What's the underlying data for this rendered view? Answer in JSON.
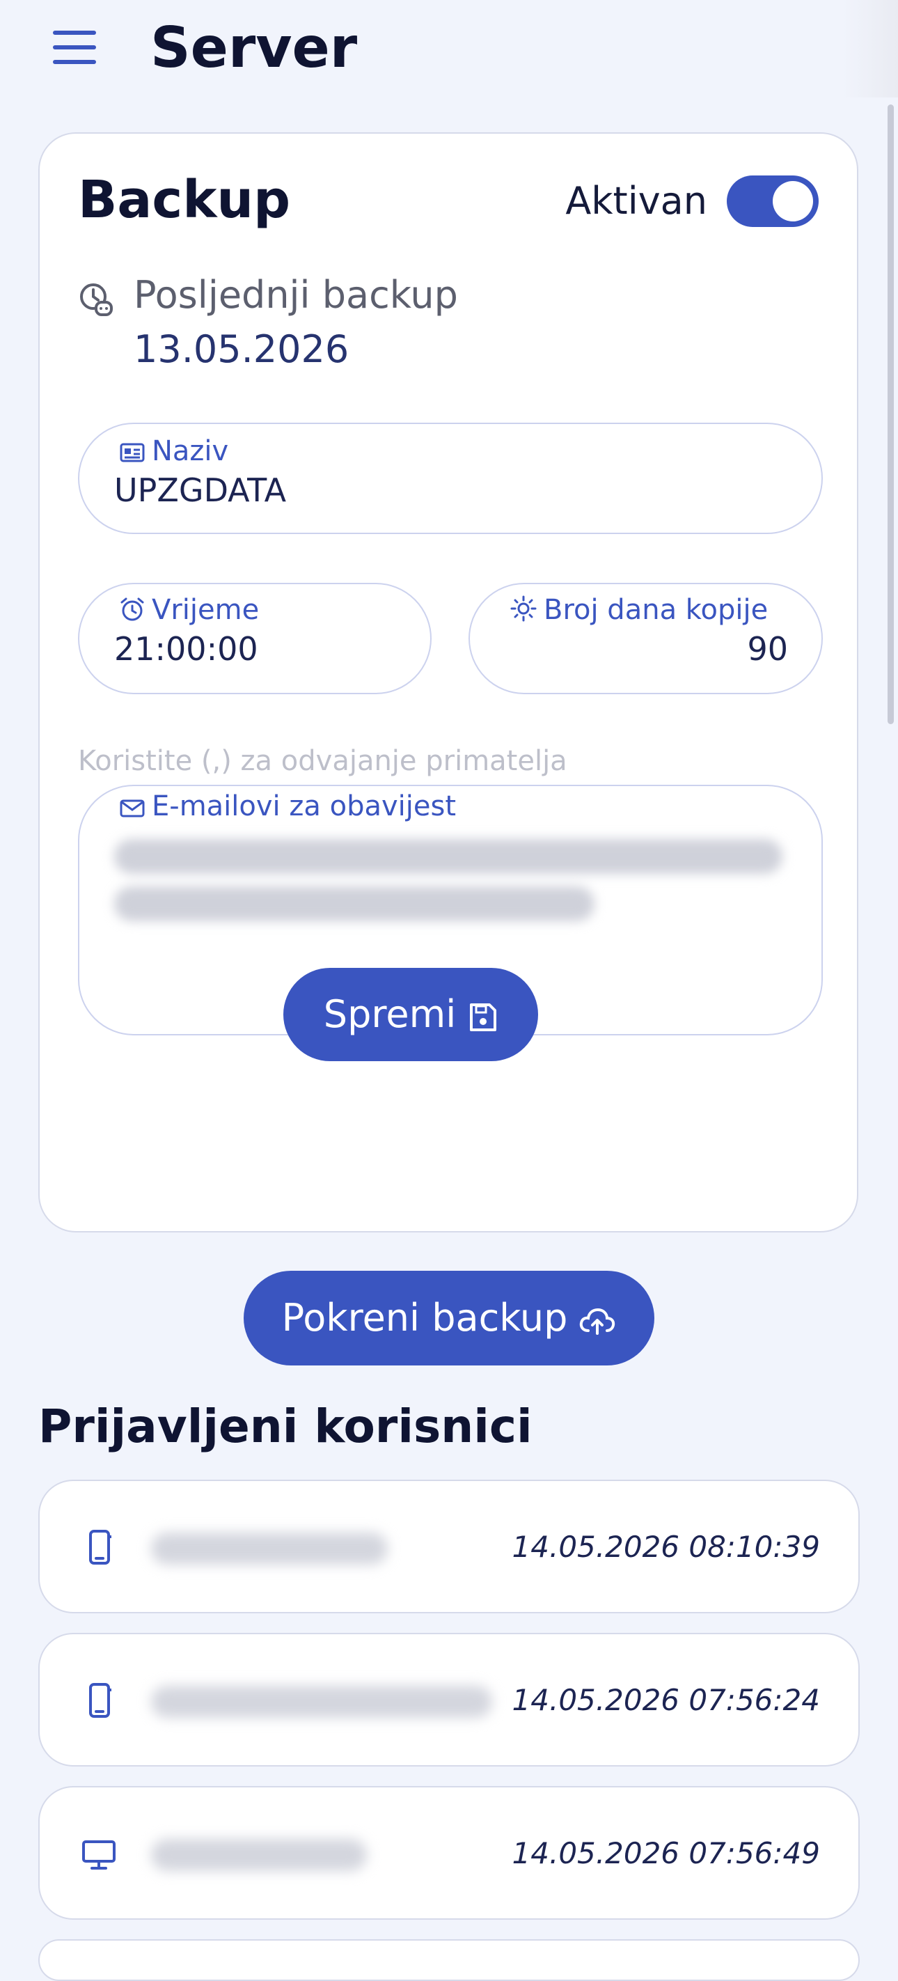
{
  "header": {
    "title": "Server",
    "menu_icon": "hamburger-menu-icon"
  },
  "backup_card": {
    "title": "Backup",
    "active_label": "Aktivan",
    "active": true,
    "last_backup_label": "Posljednji backup",
    "last_backup_value": "13.05.2026",
    "fields": {
      "naziv": {
        "label": "Naziv",
        "value": "UPZGDATA",
        "icon": "id-card-icon"
      },
      "vrijeme": {
        "label": "Vrijeme",
        "value": "21:00:00",
        "icon": "alarm-clock-icon"
      },
      "broj_dana": {
        "label": "Broj dana kopije",
        "value": "90",
        "icon": "sun-icon"
      },
      "emails": {
        "label": "E-mailovi za obavijest",
        "hint": "Koristite (,) za odvajanje primatelja",
        "icon": "mail-icon"
      }
    },
    "save_label": "Spremi"
  },
  "run_backup_label": "Pokreni backup",
  "users_section": {
    "title": "Prijavljeni korisnici",
    "users": [
      {
        "device": "mobile-icon",
        "timestamp": "14.05.2026 08:10:39"
      },
      {
        "device": "mobile-icon",
        "timestamp": "14.05.2026 07:56:24"
      },
      {
        "device": "desktop-icon",
        "timestamp": "14.05.2026 07:56:49"
      }
    ]
  },
  "colors": {
    "accent": "#3a55c0",
    "background": "#f1f4fc",
    "card": "#ffffff"
  }
}
